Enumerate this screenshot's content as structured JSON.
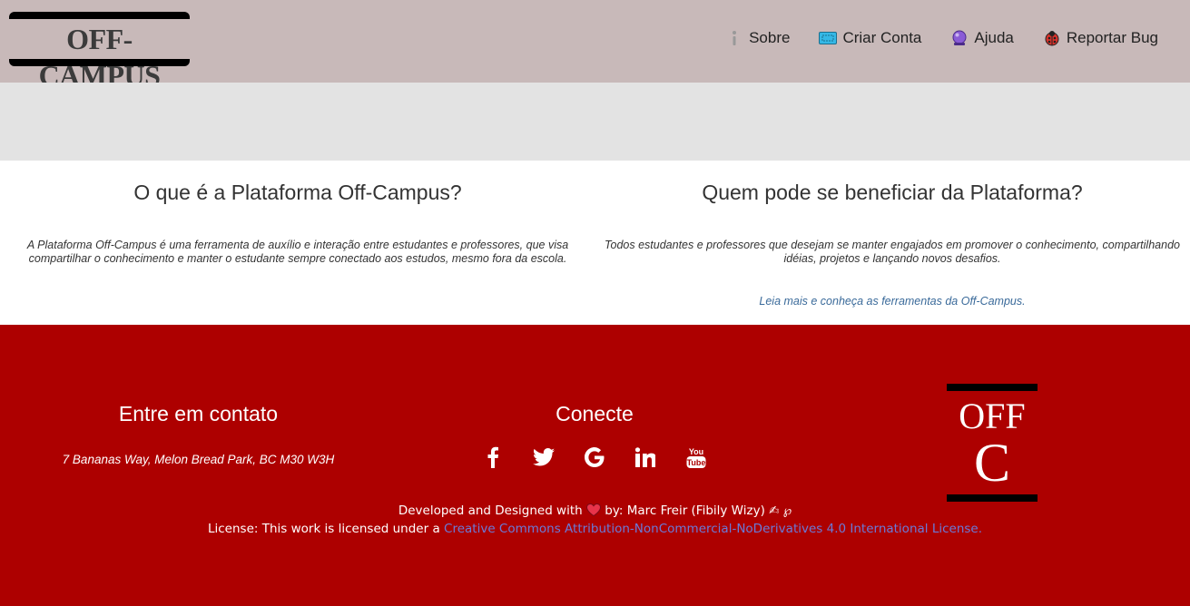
{
  "header": {
    "logo_text": "OFF-CAMPUS",
    "nav": [
      {
        "label": "Sobre",
        "icon": "info-icon"
      },
      {
        "label": "Criar Conta",
        "icon": "ticket-icon"
      },
      {
        "label": "Ajuda",
        "icon": "crystal-ball-icon"
      },
      {
        "label": "Reportar Bug",
        "icon": "ladybug-icon"
      }
    ]
  },
  "main": {
    "left": {
      "title": "O que é a Plataforma Off-Campus?",
      "text": "A Plataforma Off-Campus é uma ferramenta de auxílio e interação entre estudantes e professores, que visa compartilhar o conhecimento e manter o estudante sempre conectado aos estudos, mesmo fora da escola."
    },
    "right": {
      "title": "Quem pode se beneficiar da Plataforma?",
      "text": "Todos estudantes e professores que desejam se manter engajados em promover o conhecimento, compartilhando idéias, projetos e lançando novos desafios.",
      "link": "Leia mais e conheça as ferramentas da Off-Campus."
    }
  },
  "footer": {
    "contact_title": "Entre em contato",
    "address": "7 Bananas Way, Melon Bread Park, BC M30 W3H",
    "connect_title": "Conecte",
    "socials": [
      "facebook-icon",
      "twitter-icon",
      "google-icon",
      "linkedin-icon",
      "youtube-icon"
    ],
    "logo_line1": "OFF",
    "logo_line2": "C",
    "credit_prefix": "Developed and Designed with",
    "credit_suffix": "by: Marc Freir (Fibily Wizy) ✍ ℘",
    "license_prefix": "License: This work is licensed under a",
    "license_link": "Creative Commons Attribution-NonCommercial-NoDerivatives 4.0 International License."
  },
  "colors": {
    "header_bg": "#c8b9b9",
    "band_bg": "#e3e3e3",
    "footer_bg": "#ad0000",
    "link": "#3a6a9a"
  }
}
